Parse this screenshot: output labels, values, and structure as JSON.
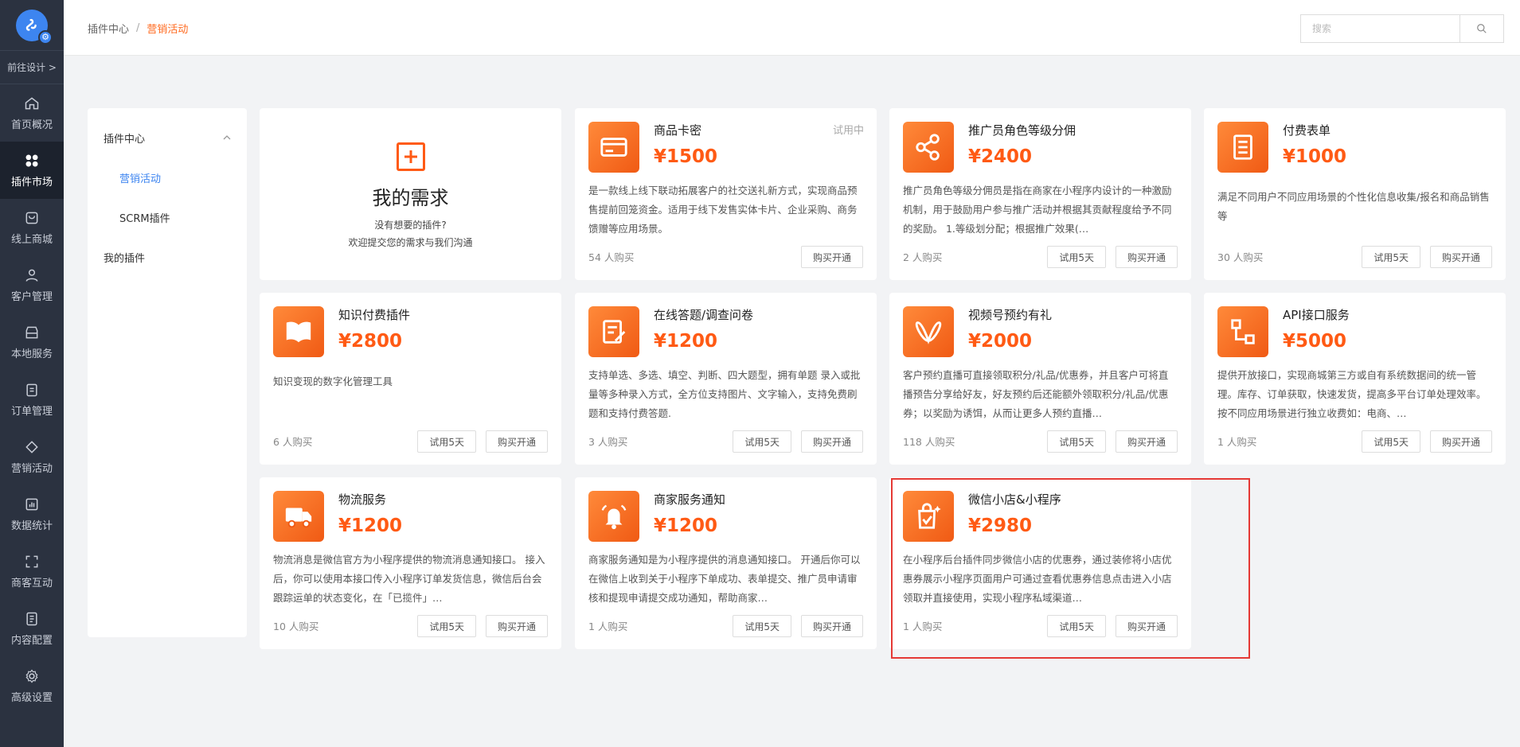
{
  "nav": {
    "goto_label": "前往设计 >",
    "items": [
      {
        "label": "首页概况",
        "icon": "home-icon"
      },
      {
        "label": "插件市场",
        "icon": "apps-icon",
        "active": true
      },
      {
        "label": "线上商城",
        "icon": "shop-icon"
      },
      {
        "label": "客户管理",
        "icon": "user-icon"
      },
      {
        "label": "本地服务",
        "icon": "store-icon"
      },
      {
        "label": "订单管理",
        "icon": "clipboard-icon"
      },
      {
        "label": "营销活动",
        "icon": "diamond-icon"
      },
      {
        "label": "数据统计",
        "icon": "chart-icon"
      },
      {
        "label": "商客互动",
        "icon": "scan-icon"
      },
      {
        "label": "内容配置",
        "icon": "doc-icon"
      },
      {
        "label": "高级设置",
        "icon": "gear-icon"
      }
    ]
  },
  "breadcrumb": {
    "root": "插件中心",
    "separator": "/",
    "current": "营销活动"
  },
  "search": {
    "placeholder": "搜索"
  },
  "subnav": {
    "group_label": "插件中心",
    "items": [
      "营销活动",
      "SCRM插件"
    ],
    "my_plugins": "我的插件"
  },
  "need_card": {
    "title": "我的需求",
    "line1": "没有想要的插件?",
    "line2": "欢迎提交您的需求与我们沟通"
  },
  "buttons": {
    "trial": "试用5天",
    "buy": "购买开通"
  },
  "cards": [
    {
      "name": "商品卡密",
      "price": "¥1500",
      "tag": "试用中",
      "desc": "是一款线上线下联动拓展客户的社交送礼新方式，实现商品预售提前回笼资金。适用于线下发售实体卡片、企业采购、商务馈赠等应用场景。",
      "buyers": "54 人购买"
    },
    {
      "name": "推广员角色等级分佣",
      "price": "¥2400",
      "desc": "推广员角色等级分佣员是指在商家在小程序内设计的一种激励机制，用于鼓励用户参与推广活动并根据其贡献程度给予不同的奖励。 1.等级划分配；根据推广效果(…",
      "buyers": "2 人购买"
    },
    {
      "name": "付费表单",
      "price": "¥1000",
      "desc": "满足不同用户不同应用场景的个性化信息收集/报名和商品销售等",
      "buyers": "30 人购买"
    },
    {
      "name": "知识付费插件",
      "price": "¥2800",
      "desc": "知识变现的数字化管理工具",
      "buyers": "6 人购买"
    },
    {
      "name": "在线答题/调查问卷",
      "price": "¥1200",
      "desc": "支持单选、多选、填空、判断、四大题型，拥有单题 录入或批量等多种录入方式，全方位支持图片、文字输入，支持免费刷题和支持付费答题.",
      "buyers": "3 人购买"
    },
    {
      "name": "视频号预约有礼",
      "price": "¥2000",
      "desc": "客户预约直播可直接领取积分/礼品/优惠券，并且客户可将直播预告分享给好友，好友预约后还能额外领取积分/礼品/优惠券；以奖励为诱饵，从而让更多人预约直播…",
      "buyers": "118 人购买"
    },
    {
      "name": "API接口服务",
      "price": "¥5000",
      "desc": "提供开放接口，实现商城第三方或自有系统数据间的统一管理。库存、订单获取，快速发货，提高多平台订单处理效率。按不同应用场景进行独立收费如：电商、…",
      "buyers": "1 人购买"
    },
    {
      "name": "物流服务",
      "price": "¥1200",
      "desc": "物流消息是微信官方为小程序提供的物流消息通知接口。 接入后，你可以使用本接口传入小程序订单发货信息，微信后台会跟踪运单的状态变化，在「已揽件」…",
      "buyers": "10 人购买"
    },
    {
      "name": "商家服务通知",
      "price": "¥1200",
      "desc": "商家服务通知是为小程序提供的消息通知接口。 开通后你可以在微信上收到关于小程序下单成功、表单提交、推广员申请审核和提现申请提交成功通知，帮助商家…",
      "buyers": "1 人购买"
    },
    {
      "name": "微信小店&小程序",
      "price": "¥2980",
      "desc": "在小程序后台插件同步微信小店的优惠券，通过装修将小店优惠券展示小程序页面用户可通过查看优惠券信息点击进入小店领取并直接使用，实现小程序私域渠道…",
      "buyers": "1 人购买"
    }
  ],
  "colors": {
    "accent": "#ff5a14",
    "nav_bg": "#2b3240",
    "link": "#3d85f0",
    "highlight": "#e53935"
  }
}
